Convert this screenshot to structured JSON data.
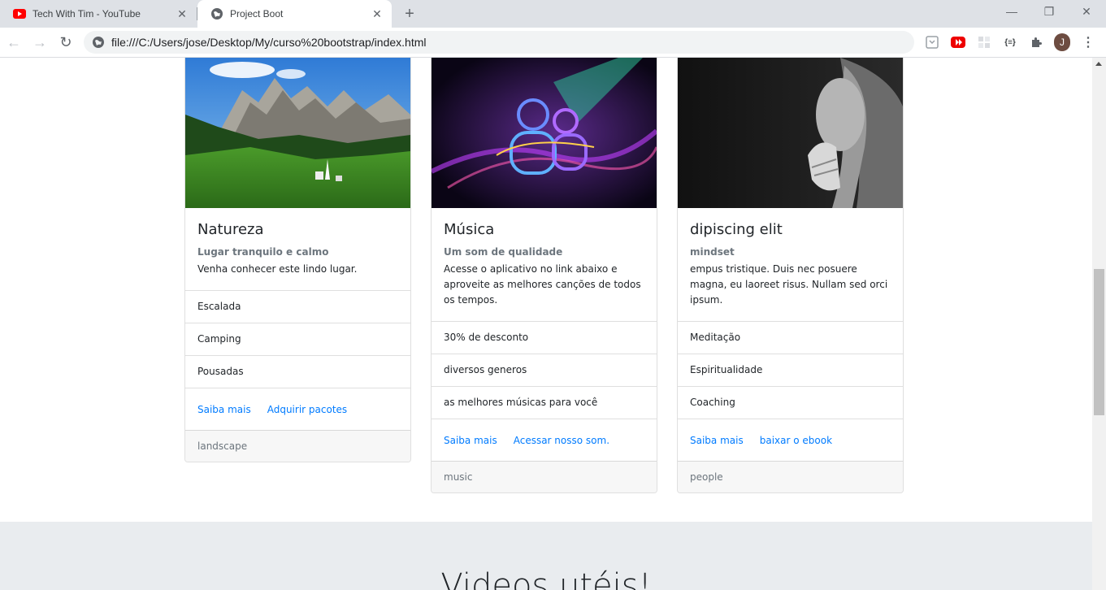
{
  "browser": {
    "tabs": [
      {
        "title": "Tech With Tim - YouTube",
        "icon": "youtube-icon",
        "active": false
      },
      {
        "title": "Project Boot",
        "icon": "globe-icon",
        "active": true
      }
    ],
    "new_tab": "+",
    "url": "file:///C:/Users/jose/Desktop/My/curso%20bootstrap/index.html",
    "profile_initial": "J"
  },
  "cards": [
    {
      "title": "Natureza",
      "subtitle": "Lugar tranquilo e calmo",
      "text": "Venha conhecer este lindo lugar.",
      "items": [
        "Escalada",
        "Camping",
        "Pousadas"
      ],
      "links": [
        "Saiba mais",
        "Adquirir pacotes"
      ],
      "footer": "landscape",
      "image": "mountain-landscape-image"
    },
    {
      "title": "Música",
      "subtitle": "Um som de qualidade",
      "text": "Acesse o aplicativo no link abaixo e aproveite as melhores canções de todos os tempos.",
      "items": [
        "30% de desconto",
        "diversos generos",
        "as melhores músicas para você"
      ],
      "links": [
        "Saiba mais",
        "Acessar nosso som."
      ],
      "footer": "music",
      "image": "neon-music-image"
    },
    {
      "title": "dipiscing elit",
      "subtitle": "mindset",
      "text": "empus tristique. Duis nec posuere magna, eu laoreet risus. Nullam sed orci ipsum.",
      "items": [
        "Meditação",
        "Espiritualidade",
        "Coaching"
      ],
      "links": [
        "Saiba mais",
        "baixar o ebook"
      ],
      "footer": "people",
      "image": "praying-woman-image"
    }
  ],
  "section_heading": "Videos utéis!",
  "colors": {
    "link": "#007bff",
    "muted": "#6c757d",
    "section_bg": "#e9ecef",
    "footer_bg": "#f7f7f7"
  }
}
